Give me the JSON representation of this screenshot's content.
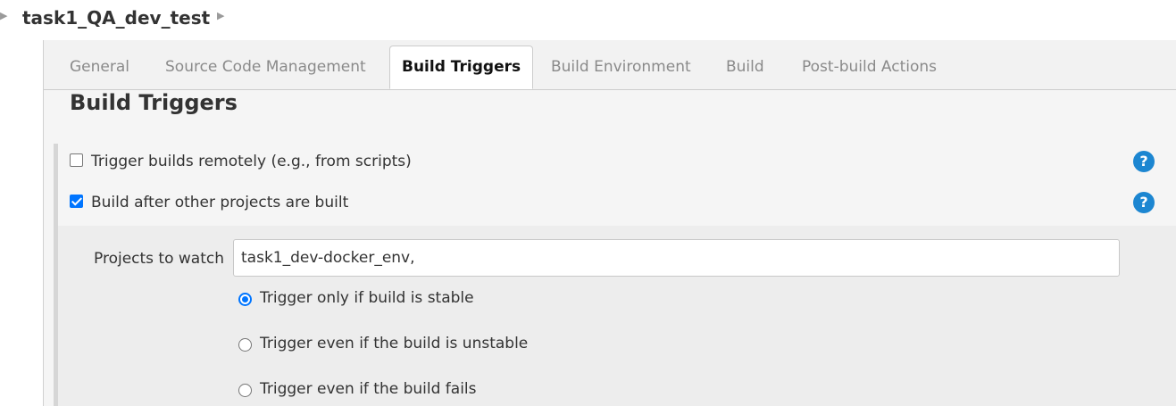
{
  "breadcrumb": {
    "project_name": "task1_QA_dev_test"
  },
  "tabs": [
    {
      "label": "General",
      "active": false
    },
    {
      "label": "Source Code Management",
      "active": false
    },
    {
      "label": "Build Triggers",
      "active": true
    },
    {
      "label": "Build Environment",
      "active": false
    },
    {
      "label": "Build",
      "active": false
    },
    {
      "label": "Post-build Actions",
      "active": false
    }
  ],
  "section": {
    "title": "Build Triggers"
  },
  "triggers": [
    {
      "label": "Trigger builds remotely (e.g., from scripts)",
      "checked": false
    },
    {
      "label": "Build after other projects are built",
      "checked": true
    }
  ],
  "help_icon_glyph": "?",
  "projects_to_watch": {
    "label": "Projects to watch",
    "value": "task1_dev-docker_env,"
  },
  "trigger_conditions": [
    {
      "label": "Trigger only if build is stable",
      "selected": true
    },
    {
      "label": "Trigger even if the build is unstable",
      "selected": false
    },
    {
      "label": "Trigger even if the build fails",
      "selected": false
    }
  ],
  "colors": {
    "accent": "#0075ff",
    "help_icon": "#1c86d1",
    "tab_bar": "#f2f2f2",
    "panel": "#f5f5f5",
    "sub_panel": "#ededed"
  }
}
